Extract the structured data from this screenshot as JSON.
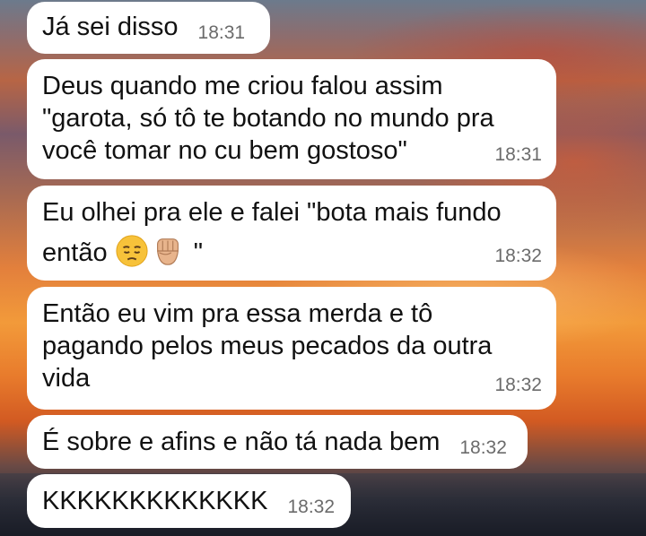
{
  "messages": [
    {
      "text": "Já sei disso",
      "time": "18:31"
    },
    {
      "text": "Deus quando me criou falou assim\n\"garota, só tô te botando no mundo pra\nvocê tomar no cu bem gostoso\"",
      "time": "18:31"
    },
    {
      "text_line1": "Eu olhei pra ele e falei \"bota mais fundo",
      "text_line2_prefix": "então ",
      "text_line2_suffix": " \"",
      "emojis": [
        "pensive-face-icon",
        "raised-fist-icon"
      ],
      "time": "18:32"
    },
    {
      "text": "Então eu vim pra essa merda e tô\npagando pelos meus pecados da outra\nvida",
      "time": "18:32"
    },
    {
      "text": "É sobre e afins e não tá nada bem",
      "time": "18:32"
    },
    {
      "text": "KKKKKKKKKKKKK",
      "time": "18:32"
    }
  ],
  "colors": {
    "bubble": "#ffffff",
    "text": "#111111",
    "time": "#6b6b6b"
  }
}
